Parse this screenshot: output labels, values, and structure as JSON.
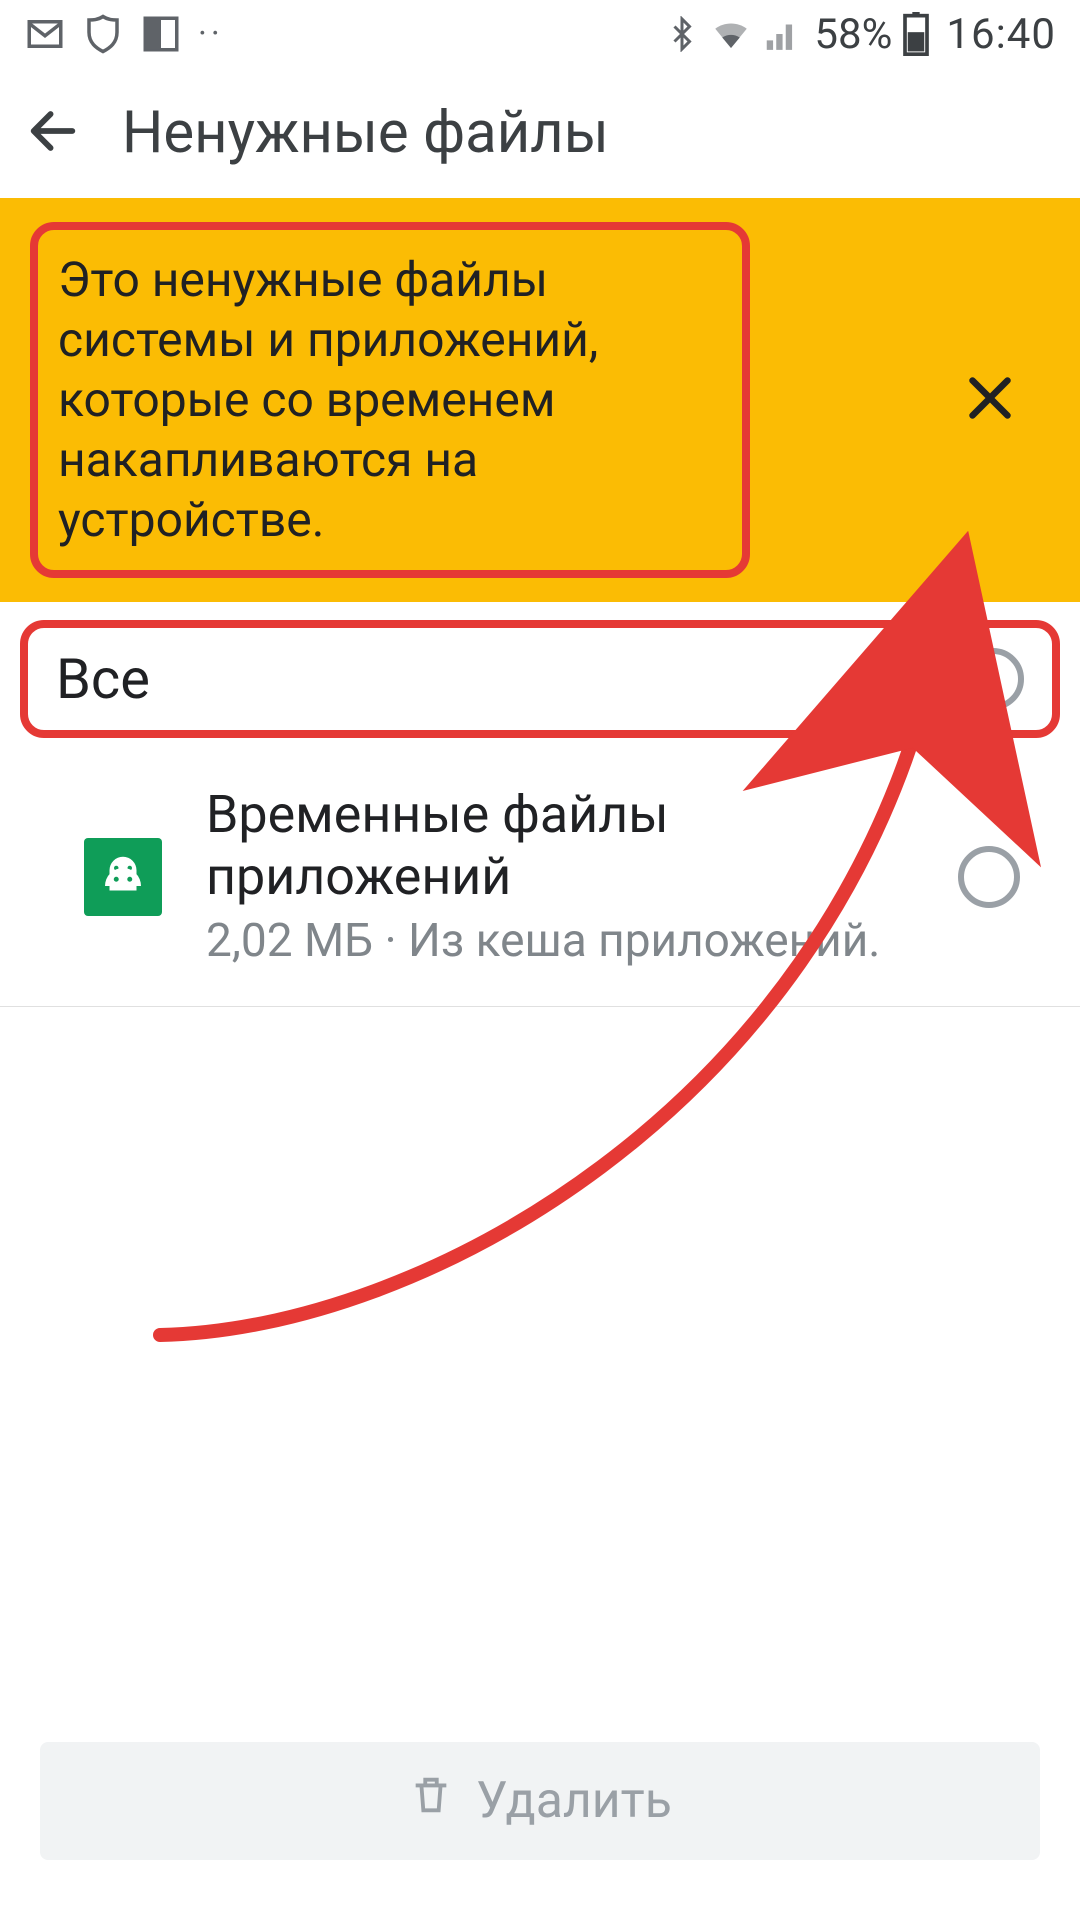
{
  "status": {
    "battery_pct": "58%",
    "time": "16:40"
  },
  "appbar": {
    "title": "Ненужные файлы"
  },
  "banner": {
    "text": "Это ненужные файлы системы и приложений, которые со временем накапливаются на устройстве."
  },
  "all_row": {
    "label": "Все"
  },
  "item": {
    "title": "Временные файлы приложений",
    "subtitle": "2,02 МБ · Из кеша приложений."
  },
  "delete": {
    "label": "Удалить"
  },
  "colors": {
    "accent_yellow": "#fbbc04",
    "annotation_red": "#e53935",
    "android_green": "#0f9d58"
  }
}
